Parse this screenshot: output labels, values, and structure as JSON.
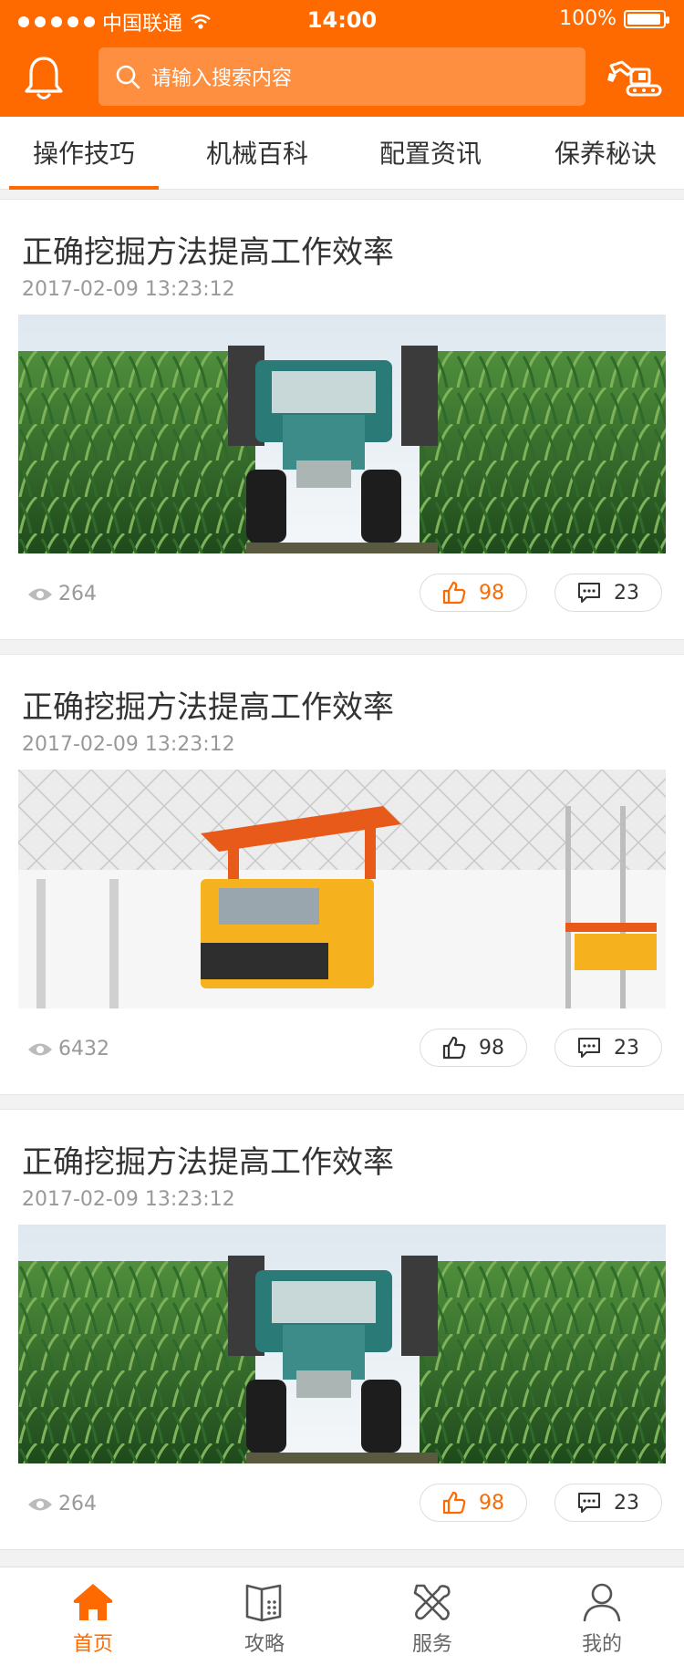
{
  "status_bar": {
    "carrier": "中国联通",
    "time": "14:00",
    "battery": "100%"
  },
  "search": {
    "placeholder": "请输入搜索内容"
  },
  "tabs": [
    {
      "label": "操作技巧",
      "active": true
    },
    {
      "label": "机械百科",
      "active": false
    },
    {
      "label": "配置资讯",
      "active": false
    },
    {
      "label": "保养秘诀",
      "active": false
    }
  ],
  "articles": [
    {
      "title": "正确挖掘方法提高工作效率",
      "date": "2017-02-09 13:23:12",
      "image": "tractor-in-cornfield",
      "views": "264",
      "likes": "98",
      "liked": true,
      "comments": "23"
    },
    {
      "title": "正确挖掘方法提高工作效率",
      "date": "2017-02-09 13:23:12",
      "image": "truck-assembly-plant",
      "views": "6432",
      "likes": "98",
      "liked": false,
      "comments": "23"
    },
    {
      "title": "正确挖掘方法提高工作效率",
      "date": "2017-02-09 13:23:12",
      "image": "tractor-in-cornfield",
      "views": "264",
      "likes": "98",
      "liked": true,
      "comments": "23"
    }
  ],
  "bottom_nav": [
    {
      "label": "首页",
      "icon": "home-icon",
      "active": true
    },
    {
      "label": "攻略",
      "icon": "book-icon",
      "active": false
    },
    {
      "label": "服务",
      "icon": "tools-icon",
      "active": false
    },
    {
      "label": "我的",
      "icon": "user-icon",
      "active": false
    }
  ],
  "colors": {
    "brand": "#ff6a00",
    "text": "#333333",
    "muted": "#999999"
  }
}
